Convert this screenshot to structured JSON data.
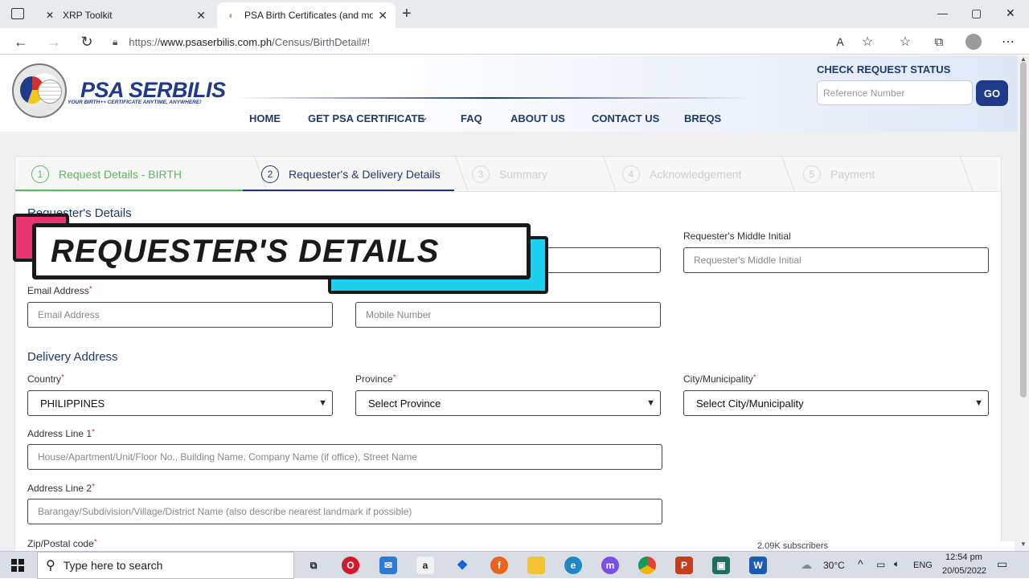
{
  "tabs": [
    {
      "title": "XRP Toolkit",
      "icon": "xrp-logo-icon"
    },
    {
      "title": "PSA Birth Certificates (and more)",
      "icon": "psa-favicon-icon"
    }
  ],
  "window_controls": {
    "minimize": "—",
    "maximize": "▢",
    "close": "✕"
  },
  "address_bar": {
    "url_prefix": "https://",
    "url_domain": "www.psaserbilis.com.ph",
    "url_path": "/Census/BirthDetail#!"
  },
  "header": {
    "brand": "PSA SERBILIS",
    "tagline": "YOUR BIRTH++ CERTIFICATE ANYTIME, ANYWHERE!",
    "menu": [
      "HOME",
      "GET PSA CERTIFICATE",
      "FAQ",
      "ABOUT US",
      "CONTACT US",
      "BREQS"
    ],
    "check_status": {
      "title": "CHECK REQUEST STATUS",
      "placeholder": "Reference Number",
      "button": "GO"
    }
  },
  "steps": [
    {
      "num": "1",
      "label": "Request Details - BIRTH",
      "state": "done"
    },
    {
      "num": "2",
      "label": "Requester's & Delivery Details",
      "state": "active"
    },
    {
      "num": "3",
      "label": "Summary",
      "state": "pending"
    },
    {
      "num": "4",
      "label": "Acknowledgement",
      "state": "pending"
    },
    {
      "num": "5",
      "label": "Payment",
      "state": "pending"
    }
  ],
  "form": {
    "section_requester": "Requester's Details",
    "middle_initial_label": "Requester's Middle Initial",
    "middle_initial_placeholder": "Requester's Middle Initial",
    "email_label": "Email Address",
    "email_placeholder": "Email Address",
    "mobile_placeholder": "Mobile Number",
    "section_delivery": "Delivery Address",
    "country_label": "Country",
    "country_value": "PHILIPPINES",
    "province_label": "Province",
    "province_value": "Select Province",
    "city_label": "City/Municipality",
    "city_value": "Select City/Municipality",
    "address1_label": "Address Line 1",
    "address1_placeholder": "House/Apartment/Unit/Floor No., Building Name, Company Name (if office), Street Name",
    "address2_label": "Address Line 2",
    "address2_placeholder": "Barangay/Subdivision/Village/District Name (also describe nearest landmark if possible)",
    "zip_label": "Zip/Postal code",
    "required_mark": "*"
  },
  "overlay": {
    "title": "REQUESTER'S DETAILS"
  },
  "popup_fragment": "2.09K subscribers",
  "taskbar": {
    "search_placeholder": "Type here to search",
    "temperature": "30°C",
    "language": "ENG",
    "time": "12:54 pm",
    "date": "20/05/2022"
  },
  "colors": {
    "accent_blue": "#1e3a8a",
    "step_green": "#5cb85c",
    "overlay_pink": "#e8356f",
    "overlay_cyan": "#1ed0f0"
  }
}
